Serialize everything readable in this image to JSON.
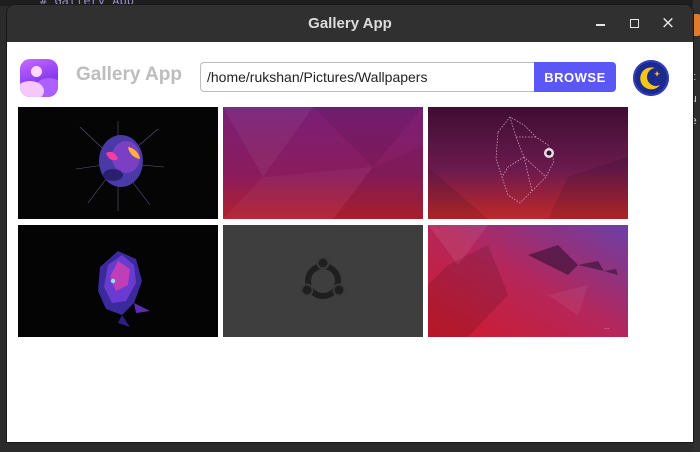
{
  "background": {
    "code_snippet": "# Gallery App",
    "right_text": [
      "c",
      "u",
      "e"
    ]
  },
  "window": {
    "title": "Gallery App",
    "controls": {
      "minimize": "–",
      "maximize": "□",
      "close": "×"
    }
  },
  "app": {
    "name": "Gallery App",
    "logo_icon": "gallery-logo-icon",
    "path_value": "/home/rukshan/Pictures/Wallpapers",
    "browse_label": "BROWSE",
    "theme_icon": "moon-icon",
    "accent_color": "#5b56f6"
  },
  "gallery": {
    "columns": 3,
    "images": [
      {
        "name": "spiderman-dark-wallpaper",
        "style": "dark-spider"
      },
      {
        "name": "ubuntu-purple-wallpaper",
        "style": "purple-gradient"
      },
      {
        "name": "ubuntu-gorilla-wallpaper",
        "style": "gorilla"
      },
      {
        "name": "dark-creature-wallpaper",
        "style": "dark-creature"
      },
      {
        "name": "ubuntu-grey-logo-wallpaper",
        "style": "grey-logo"
      },
      {
        "name": "ubuntu-red-purple-wallpaper",
        "style": "red-purple"
      }
    ]
  }
}
